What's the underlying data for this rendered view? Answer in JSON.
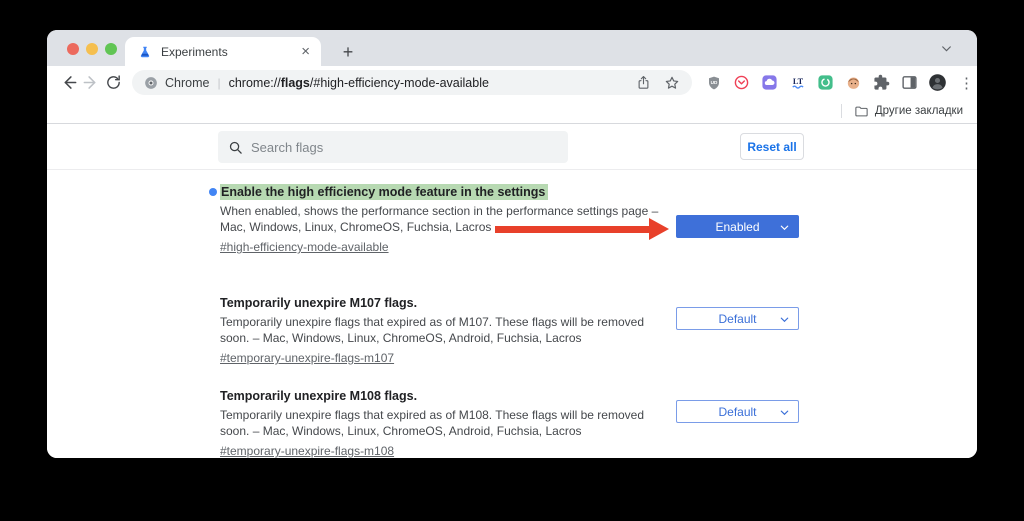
{
  "window": {
    "tab_title": "Experiments",
    "omnibox": {
      "site_label": "Chrome",
      "separator": "|",
      "url_prefix": "chrome://",
      "url_highlight": "flags",
      "url_suffix": "/#high-efficiency-mode-available"
    },
    "bookmarks_bar": {
      "other_bookmarks_label": "Другие закладки"
    }
  },
  "icons": {
    "close_tab_glyph": "×",
    "new_tab_glyph": "+",
    "menu_dots_glyph": "⋮"
  },
  "flags_page": {
    "search_placeholder": "Search flags",
    "reset_all_label": "Reset all",
    "flags": [
      {
        "title": "Enable the high efficiency mode feature in the settings",
        "highlighted": true,
        "description": "When enabled, shows the performance section in the performance settings page – Mac, Windows, Linux, ChromeOS, Fuchsia, Lacros",
        "link": "#high-efficiency-mode-available",
        "value": "Enabled"
      },
      {
        "title": "Temporarily unexpire M107 flags.",
        "highlighted": false,
        "description": "Temporarily unexpire flags that expired as of M107. These flags will be removed soon. – Mac, Windows, Linux, ChromeOS, Android, Fuchsia, Lacros",
        "link": "#temporary-unexpire-flags-m107",
        "value": "Default"
      },
      {
        "title": "Temporarily unexpire M108 flags.",
        "highlighted": false,
        "description": "Temporarily unexpire flags that expired as of M108. These flags will be removed soon. – Mac, Windows, Linux, ChromeOS, Android, Fuchsia, Lacros",
        "link": "#temporary-unexpire-flags-m108",
        "value": "Default"
      }
    ]
  },
  "colors": {
    "accent_blue": "#1a73e8",
    "enabled_dropdown_blue": "#3e70d9",
    "default_dropdown_blue": "#3a6fd8",
    "highlight_green": "#b7d9b2",
    "modified_bullet_blue": "#4285f4",
    "arrow_red": "#e8402a",
    "tabbar_gray": "#dee1e6"
  }
}
